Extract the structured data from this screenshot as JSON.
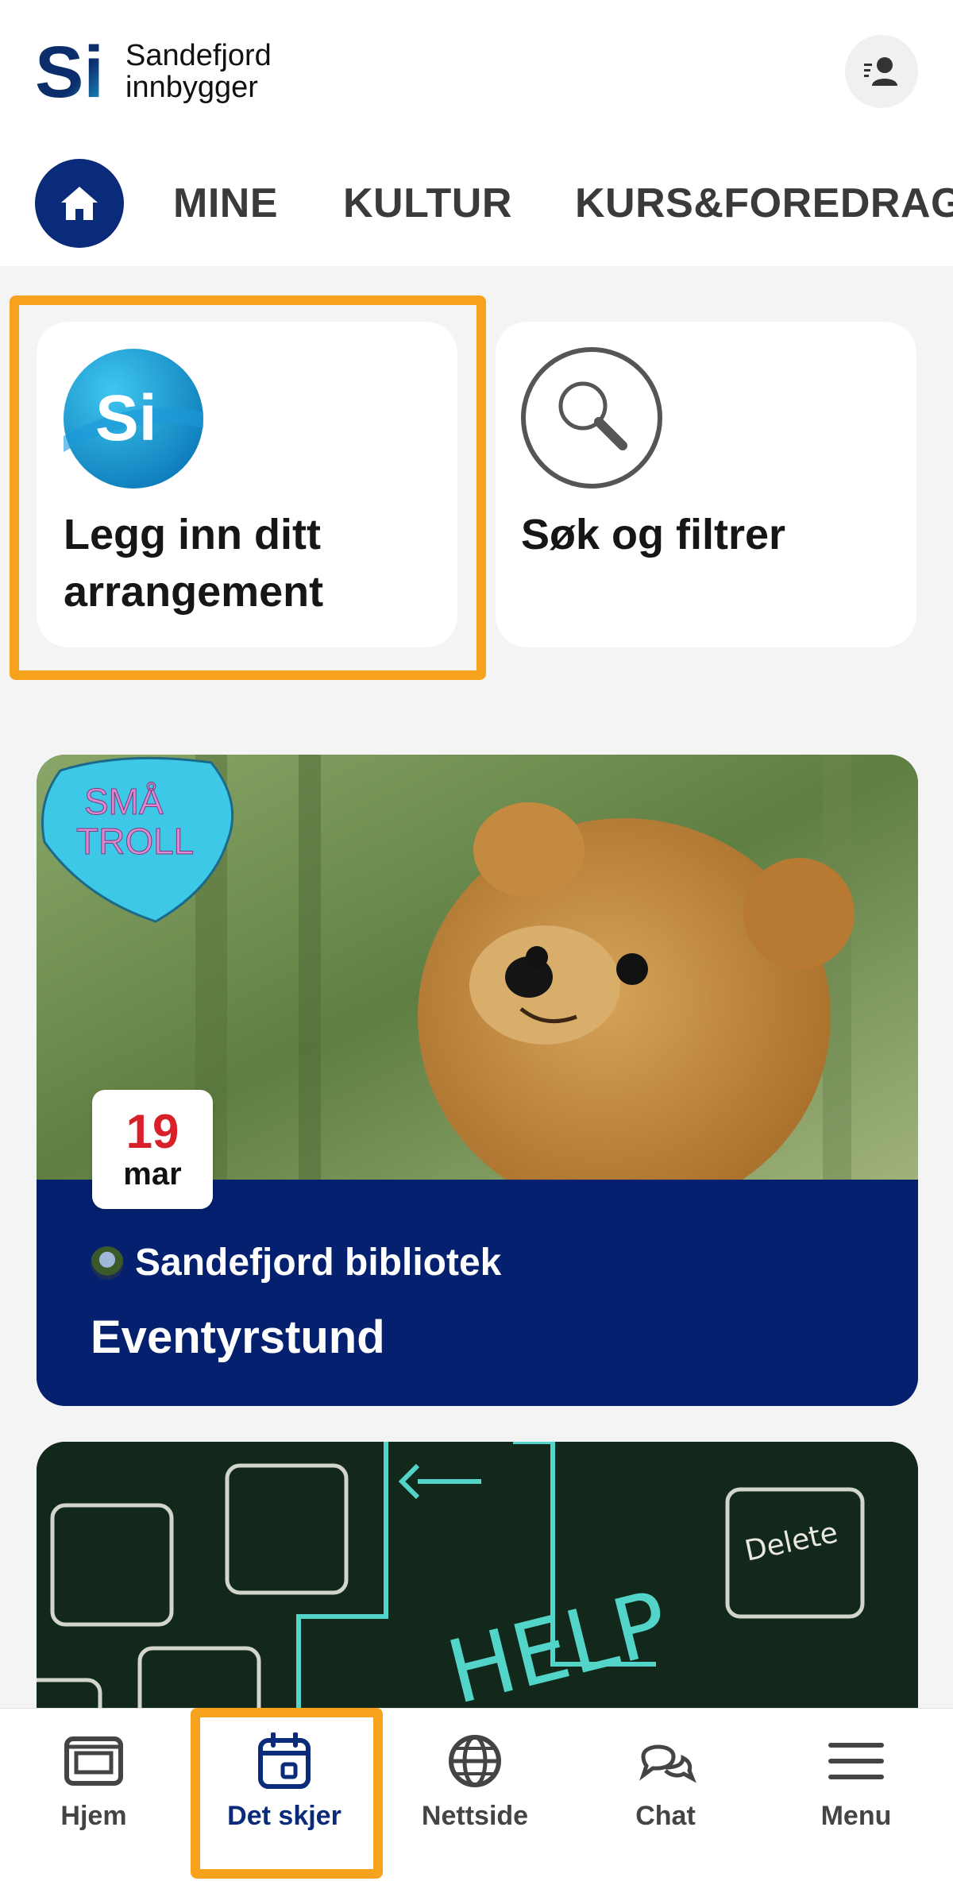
{
  "brand": {
    "logo_text": "Si",
    "line1": "Sandefjord",
    "line2": "innbygger"
  },
  "header": {
    "profile_icon": "profile-icon"
  },
  "nav": {
    "home_icon": "home-icon",
    "items": [
      {
        "label": "MINE"
      },
      {
        "label": "KULTUR"
      },
      {
        "label": "KURS&FOREDRAG"
      }
    ]
  },
  "actions": [
    {
      "title_line1": "Legg inn ditt",
      "title_line2": "arrangement",
      "icon": "si-logo-icon"
    },
    {
      "title_line1": "Søk og filtrer",
      "icon": "search-icon"
    }
  ],
  "event": {
    "badge_text": "SMÅ TROLL",
    "date_day": "19",
    "date_month": "mar",
    "organizer": "Sandefjord bibliotek",
    "title": "Eventyrstund"
  },
  "event2": {
    "image_text_help": "HELP",
    "image_text_delete": "Delete"
  },
  "tabbar": {
    "items": [
      {
        "label": "Hjem",
        "icon": "newspaper-icon"
      },
      {
        "label": "Det skjer",
        "icon": "calendar-icon",
        "active": true
      },
      {
        "label": "Nettside",
        "icon": "globe-icon"
      },
      {
        "label": "Chat",
        "icon": "chat-icon"
      },
      {
        "label": "Menu",
        "icon": "menu-icon"
      }
    ]
  },
  "colors": {
    "primary": "#0a2a7a",
    "highlight": "#f7a21c",
    "date_red": "#d8202a",
    "background": "#f4f4f4"
  }
}
